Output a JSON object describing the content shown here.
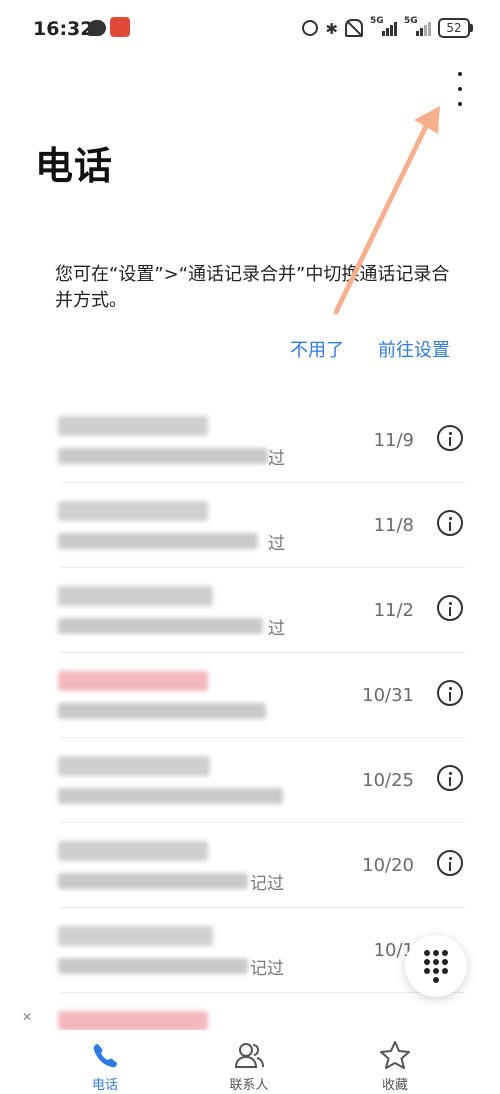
{
  "status_bar": {
    "time": "16:32",
    "signal1": "5G",
    "signal2": "5G",
    "battery": "52"
  },
  "header": {
    "title": "电话"
  },
  "tip": {
    "text": "您可在“设置”>“通话记录合并”中切换通话记录合并方式。",
    "dismiss_label": "不用了",
    "go_settings_label": "前往设置"
  },
  "calls": [
    {
      "date": "11/9",
      "sub_tail": "过",
      "name_color": "#cfcfcf"
    },
    {
      "date": "11/8",
      "sub_tail": "过",
      "name_color": "#cfcfcf"
    },
    {
      "date": "11/2",
      "sub_tail": "过",
      "name_color": "#cfcfcf"
    },
    {
      "date": "10/31",
      "sub_tail": "",
      "name_color": "#f2b8bd"
    },
    {
      "date": "10/25",
      "sub_tail": "",
      "name_color": "#cfcfcf"
    },
    {
      "date": "10/20",
      "sub_tail": "记过",
      "name_color": "#cfcfcf"
    },
    {
      "date": "10/1",
      "sub_tail": "记过",
      "name_color": "#cfcfcf"
    },
    {
      "date": "",
      "sub_tail": "",
      "name_color": "#f2b8bd"
    }
  ],
  "bottom_nav": {
    "phone_label": "电话",
    "contacts_label": "联系人",
    "favorites_label": "收藏"
  },
  "colors": {
    "accent": "#2f7be5",
    "annotation_arrow": "#f6b08e"
  }
}
